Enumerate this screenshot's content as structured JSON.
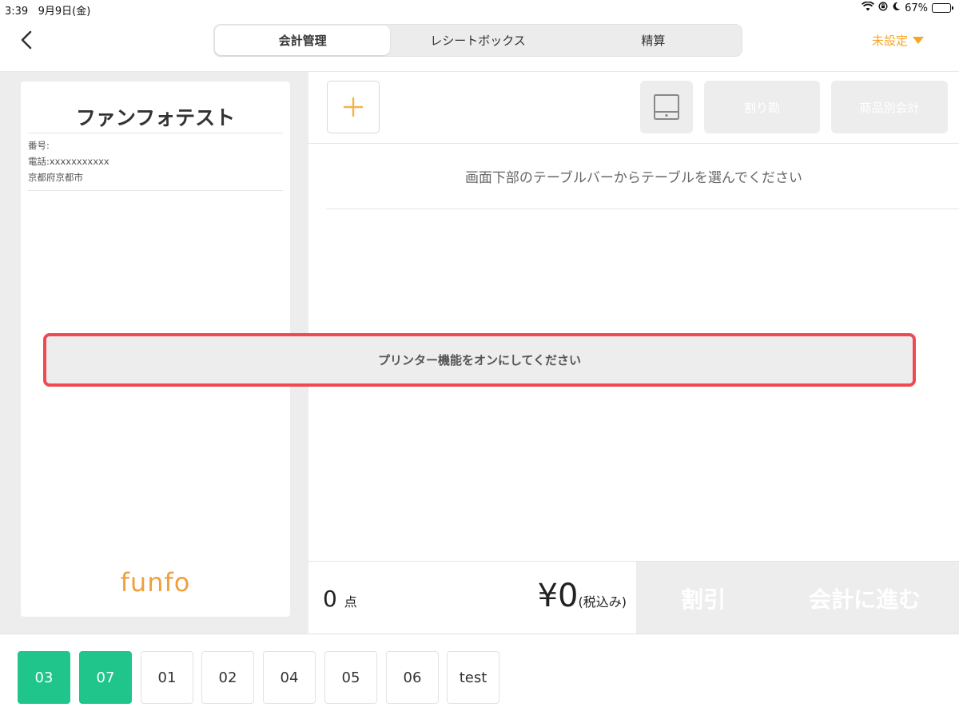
{
  "status": {
    "time": "3:39",
    "date": "9月9日(金)",
    "battery": "67%"
  },
  "header": {
    "tabs": [
      {
        "label": "会計管理",
        "active": true
      },
      {
        "label": "レシートボックス",
        "active": false
      },
      {
        "label": "精算",
        "active": false
      }
    ],
    "printer_setting": "未設定"
  },
  "receipt": {
    "shop_name": "ファンフォテスト",
    "number": "番号:",
    "phone": "電話:xxxxxxxxxxx",
    "address": "京都府京都市",
    "logo": "funfo"
  },
  "toolbar": {
    "split_label": "割り勘",
    "item_checkout_label": "商品別会計"
  },
  "main": {
    "message": "画面下部のテーブルバーからテーブルを選んでください"
  },
  "banner": {
    "message": "プリンター機能をオンにしてください"
  },
  "summary": {
    "count": "0",
    "count_unit": "点",
    "total": "¥0",
    "tax_note": "(税込み)",
    "discount_label": "割引",
    "checkout_label": "会計に進む"
  },
  "tables": [
    {
      "label": "03",
      "active": true
    },
    {
      "label": "07",
      "active": true
    },
    {
      "label": "01",
      "active": false
    },
    {
      "label": "02",
      "active": false
    },
    {
      "label": "04",
      "active": false
    },
    {
      "label": "05",
      "active": false
    },
    {
      "label": "06",
      "active": false
    },
    {
      "label": "test",
      "active": false
    }
  ],
  "colors": {
    "accent_orange": "#f5a623",
    "table_active": "#1fc58b",
    "banner_border": "#ef4a4f"
  }
}
